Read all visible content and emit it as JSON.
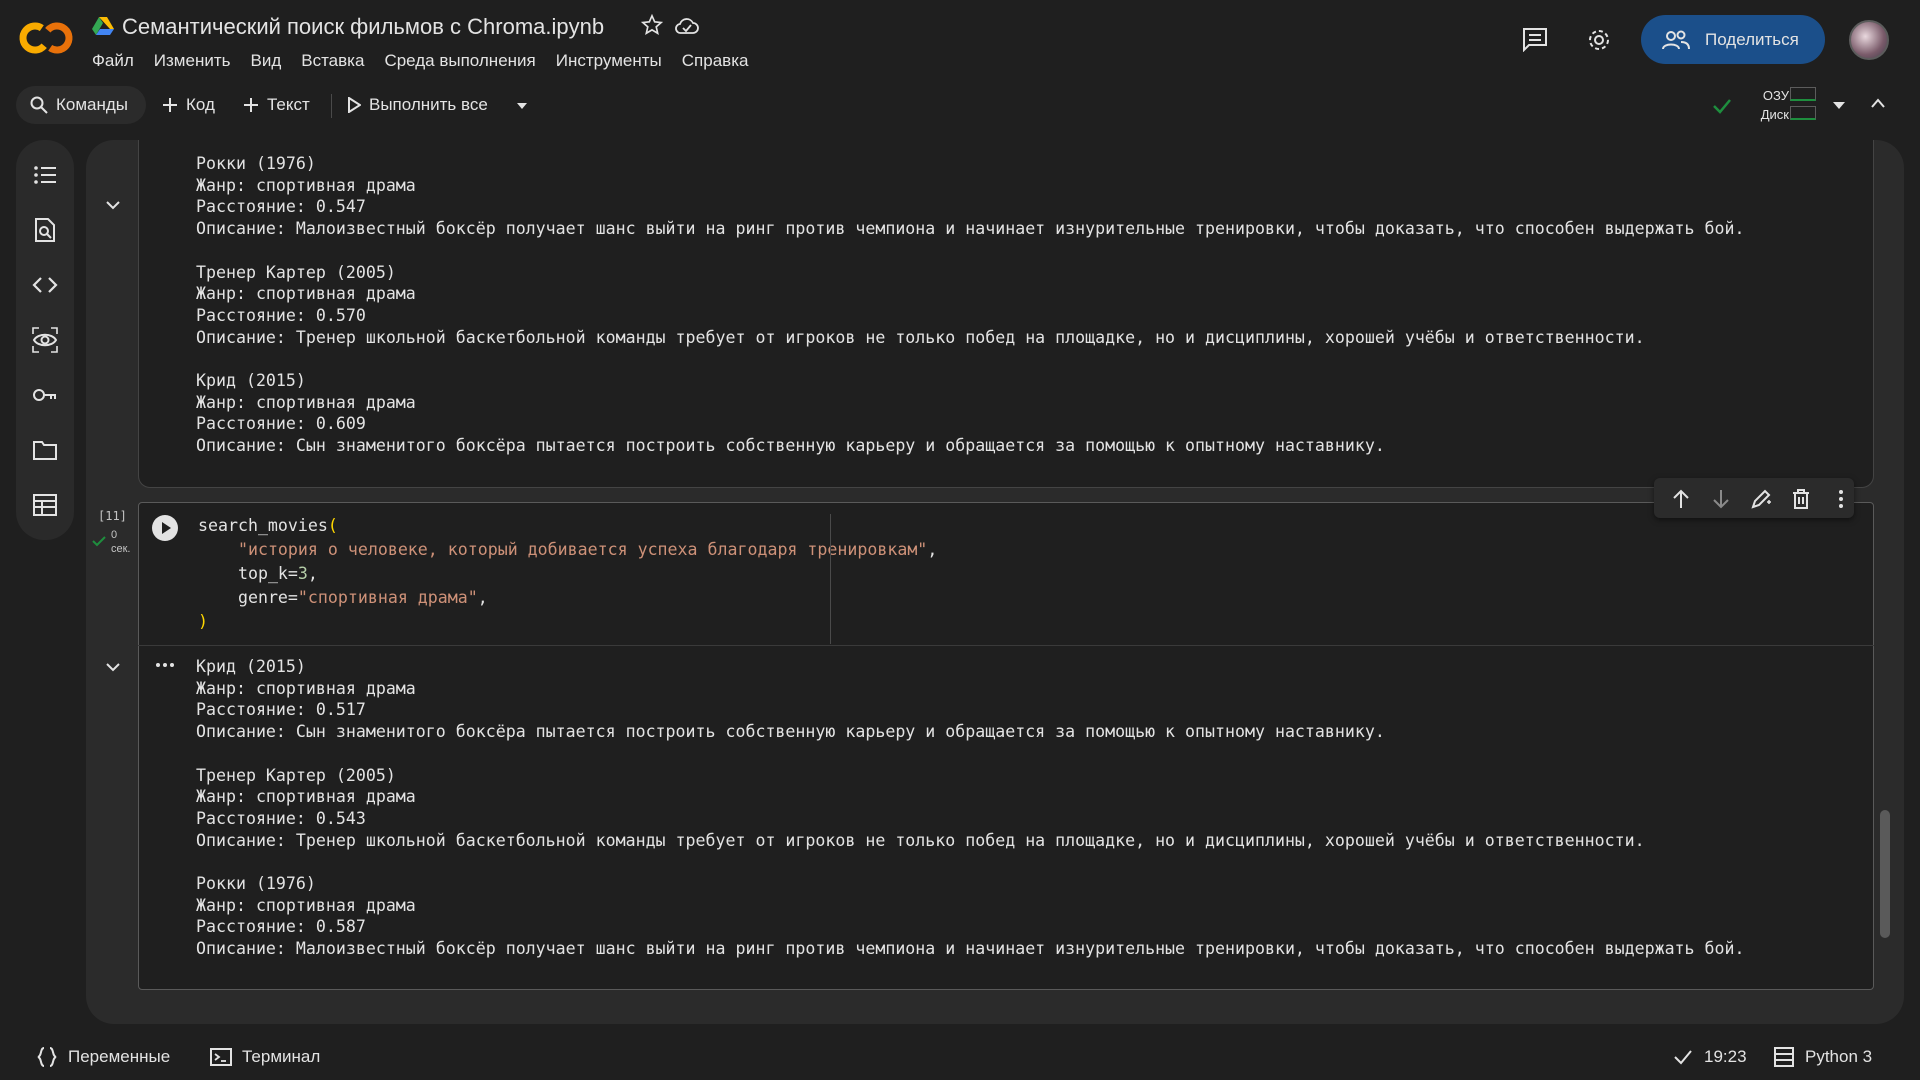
{
  "header": {
    "title": "Семантический поиск фильмов с Chroma.ipynb",
    "share_label": "Поделиться",
    "menu": [
      "Файл",
      "Изменить",
      "Вид",
      "Вставка",
      "Среда выполнения",
      "Инструменты",
      "Справка"
    ]
  },
  "toolbar": {
    "commands_label": "Команды",
    "code_label": "Код",
    "text_label": "Текст",
    "run_all_label": "Выполнить все",
    "ram_label": "ОЗУ",
    "disk_label": "Диск"
  },
  "output1": {
    "text": "Рокки (1976)\nЖанр: спортивная драма\nРасстояние: 0.547\nОписание: Малоизвестный боксёр получает шанс выйти на ринг против чемпиона и начинает изнурительные тренировки, чтобы доказать, что способен выдержать бой.\n\nТренер Картер (2005)\nЖанр: спортивная драма\nРасстояние: 0.570\nОписание: Тренер школьной баскетбольной команды требует от игроков не только побед на площадке, но и дисциплины, хорошей учёбы и ответственности.\n\nКрид (2015)\nЖанр: спортивная драма\nРасстояние: 0.609\nОписание: Сын знаменитого боксёра пытается построить собственную карьеру и обращается за помощью к опытному наставнику."
  },
  "cell": {
    "exec_count": "[11]",
    "exec_time_value": "0",
    "exec_time_unit": "сек.",
    "code": {
      "fn": "search_movies",
      "open_paren": "(",
      "query": "\"история о человеке, который добивается успеха благодаря тренировкам\"",
      "topk_name": "top_k=",
      "topk_value": "3",
      "genre_name": "genre=",
      "genre_value": "\"спортивная драма\"",
      "close_paren": ")"
    }
  },
  "output2": {
    "text": "Крид (2015)\nЖанр: спортивная драма\nРасстояние: 0.517\nОписание: Сын знаменитого боксёра пытается построить собственную карьеру и обращается за помощью к опытному наставнику.\n\nТренер Картер (2005)\nЖанр: спортивная драма\nРасстояние: 0.543\nОписание: Тренер школьной баскетбольной команды требует от игроков не только побед на площадке, но и дисциплины, хорошей учёбы и ответственности.\n\nРокки (1976)\nЖанр: спортивная драма\nРасстояние: 0.587\nОписание: Малоизвестный боксёр получает шанс выйти на ринг против чемпиона и начинает изнурительные тренировки, чтобы доказать, что способен выдержать бой."
  },
  "status": {
    "variables_label": "Переменные",
    "terminal_label": "Терминал",
    "time": "19:23",
    "runtime": "Python 3"
  },
  "colors": {
    "accent": "#1b4f8a",
    "ok_green": "#1e8e3e",
    "string": "#ce9178",
    "number": "#b5cea8"
  }
}
